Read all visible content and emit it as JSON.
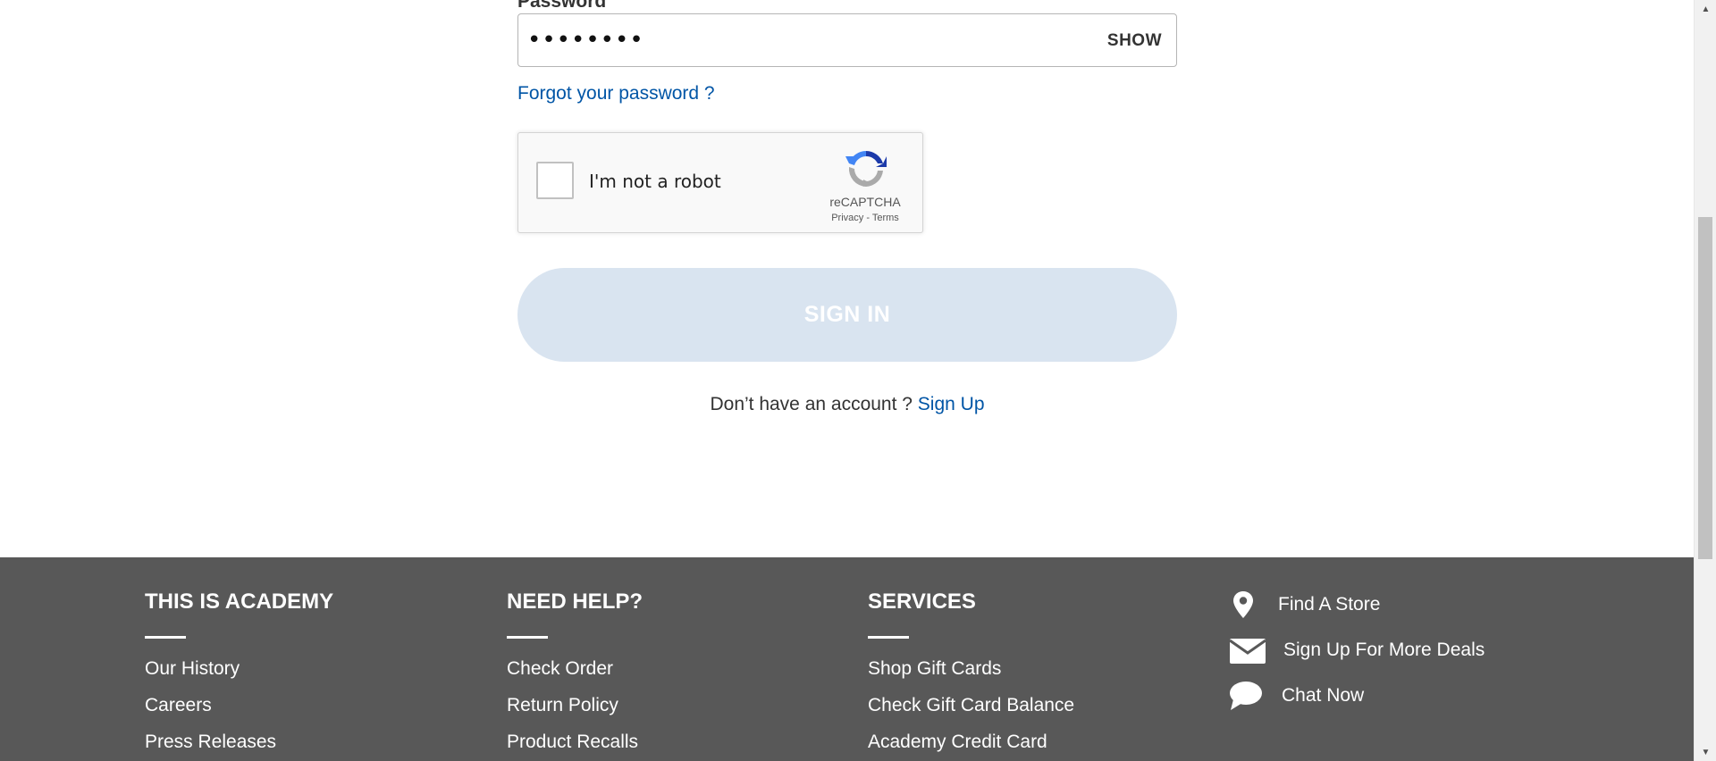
{
  "form": {
    "password_label": "Password",
    "password_value": "••••••••",
    "show_label": "SHOW",
    "forgot_label": "Forgot your password ?",
    "recaptcha": {
      "checkbox_label": "I'm not a robot",
      "brand": "reCAPTCHA",
      "privacy": "Privacy",
      "separator": " - ",
      "terms": "Terms"
    },
    "signin_label": "SIGN IN",
    "signup_prompt": "Don’t have an account ? ",
    "signup_link": "Sign Up"
  },
  "footer": {
    "columns": [
      {
        "heading": "THIS IS ACADEMY",
        "links": [
          "Our History",
          "Careers",
          "Press Releases"
        ]
      },
      {
        "heading": "NEED HELP?",
        "links": [
          "Check Order",
          "Return Policy",
          "Product Recalls"
        ]
      },
      {
        "heading": "SERVICES",
        "links": [
          "Shop Gift Cards",
          "Check Gift Card Balance",
          "Academy Credit Card"
        ]
      }
    ],
    "quick_links": [
      {
        "icon": "location-pin-icon",
        "label": "Find A Store"
      },
      {
        "icon": "envelope-icon",
        "label": "Sign Up For More Deals"
      },
      {
        "icon": "chat-bubble-icon",
        "label": "Chat Now"
      }
    ]
  },
  "colors": {
    "link_blue": "#0055a6",
    "footer_bg": "#585858",
    "signin_disabled_bg": "#d9e4f0"
  }
}
